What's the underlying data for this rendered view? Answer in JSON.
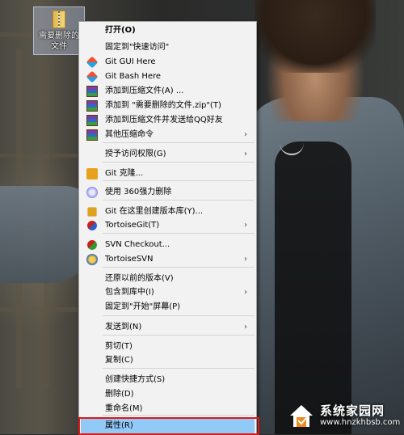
{
  "desktop": {
    "icon_label": "需要删除的文件"
  },
  "context_menu": {
    "items": [
      {
        "label": "打开(O)",
        "icon": "none",
        "submenu": false
      },
      {
        "label": "固定到\"快速访问\"",
        "icon": "none",
        "submenu": false
      },
      {
        "label": "Git GUI Here",
        "icon": "git-icon",
        "submenu": false
      },
      {
        "label": "Git Bash Here",
        "icon": "git-icon",
        "submenu": false
      },
      {
        "label": "添加到压缩文件(A) ...",
        "icon": "winrar-icon",
        "submenu": false
      },
      {
        "label": "添加到 \"需要删除的文件.zip\"(T)",
        "icon": "winrar-icon",
        "submenu": false
      },
      {
        "label": "添加到压缩文件并发送给QQ好友",
        "icon": "winrar-icon",
        "submenu": false
      },
      {
        "label": "其他压缩命令",
        "icon": "winrar-icon",
        "submenu": true
      },
      {
        "label": "授予访问权限(G)",
        "icon": "none",
        "submenu": true
      },
      {
        "label": "Git 克隆...",
        "icon": "git-clone-icon",
        "submenu": false
      },
      {
        "label": "使用 360强力删除",
        "icon": "360-icon",
        "submenu": false
      },
      {
        "label": "Git 在这里创建版本库(Y)...",
        "icon": "git-repo-icon",
        "submenu": false
      },
      {
        "label": "TortoiseGit(T)",
        "icon": "tortoisegit-icon",
        "submenu": true
      },
      {
        "label": "SVN Checkout...",
        "icon": "svn-checkout-icon",
        "submenu": false
      },
      {
        "label": "TortoiseSVN",
        "icon": "tortoisesvn-icon",
        "submenu": true
      },
      {
        "label": "还原以前的版本(V)",
        "icon": "none",
        "submenu": false
      },
      {
        "label": "包含到库中(I)",
        "icon": "none",
        "submenu": true
      },
      {
        "label": "固定到\"开始\"屏幕(P)",
        "icon": "none",
        "submenu": false
      },
      {
        "label": "发送到(N)",
        "icon": "none",
        "submenu": true
      },
      {
        "label": "剪切(T)",
        "icon": "none",
        "submenu": false
      },
      {
        "label": "复制(C)",
        "icon": "none",
        "submenu": false
      },
      {
        "label": "创建快捷方式(S)",
        "icon": "none",
        "submenu": false
      },
      {
        "label": "删除(D)",
        "icon": "none",
        "submenu": false
      },
      {
        "label": "重命名(M)",
        "icon": "none",
        "submenu": false
      },
      {
        "label": "属性(R)",
        "icon": "none",
        "submenu": false,
        "selected": true
      }
    ]
  },
  "watermark": {
    "title": "系统家园网",
    "url": "www.hnzkhbsb.com"
  },
  "colors": {
    "menu_bg": "#f2f2f2",
    "selection": "#91c9f7",
    "highlight_border": "#e01818"
  }
}
